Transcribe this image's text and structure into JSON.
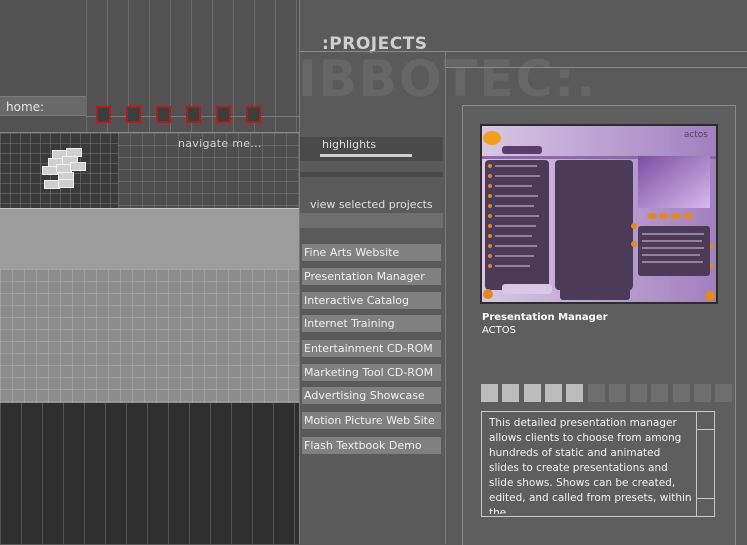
{
  "header": {
    "section_title": ":PROJECTS",
    "watermark": "IBBOTEC:."
  },
  "left": {
    "home_label": "home:",
    "navigate_label": "navigate me...",
    "nav_squares": 6
  },
  "middle": {
    "highlights_label": "highlights",
    "view_selected_label": "view selected projects",
    "projects": [
      "Fine Arts Website",
      "Presentation Manager",
      "Interactive Catalog",
      "Internet Training",
      "Entertainment CD-ROM",
      "Marketing Tool CD-ROM",
      "Advertising Showcase",
      "Motion Picture Web Site",
      "Flash Textbook Demo"
    ]
  },
  "detail": {
    "title": "Presentation Manager",
    "client": "ACTOS",
    "description": "This detailed presentation manager allows clients to choose from among hundreds of static and animated slides to create presentations and slide shows. Shows can be created, edited, and called from presets, within the",
    "screenshot_brand": "actos",
    "pager_total": 12,
    "pager_active": 5
  },
  "colors": {
    "accent_red": "#a81f1f",
    "pager_active": "#bdbdbd",
    "pager_inactive": "#6e6e6e",
    "screenshot_purple": "#b99ad0"
  }
}
